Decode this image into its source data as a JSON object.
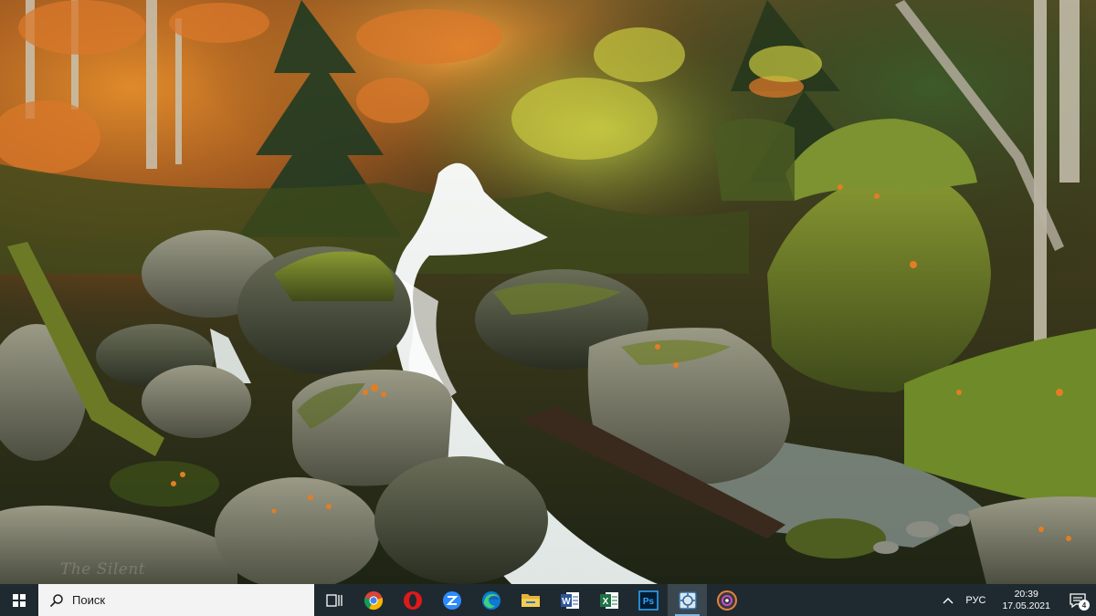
{
  "desktop": {
    "wallpaper": "forest-stream-autumn",
    "watermark_text": "The Silent"
  },
  "taskbar": {
    "background": "#1f2a30",
    "search_placeholder": "Поиск",
    "pinned": [
      {
        "name": "task-view-icon",
        "active": false
      },
      {
        "name": "chrome-icon",
        "active": false
      },
      {
        "name": "opera-icon",
        "active": false
      },
      {
        "name": "zoom-icon",
        "active": false
      },
      {
        "name": "edge-icon",
        "active": false
      },
      {
        "name": "file-explorer-icon",
        "active": false
      },
      {
        "name": "word-icon",
        "active": false
      },
      {
        "name": "excel-icon",
        "active": false
      },
      {
        "name": "photoshop-icon",
        "active": false
      },
      {
        "name": "snipping-tool-icon",
        "active": true
      },
      {
        "name": "media-player-icon",
        "active": false
      }
    ],
    "tray": {
      "language": "РУС",
      "time": "20:39",
      "date": "17.05.2021",
      "notifications_count": "4"
    }
  }
}
